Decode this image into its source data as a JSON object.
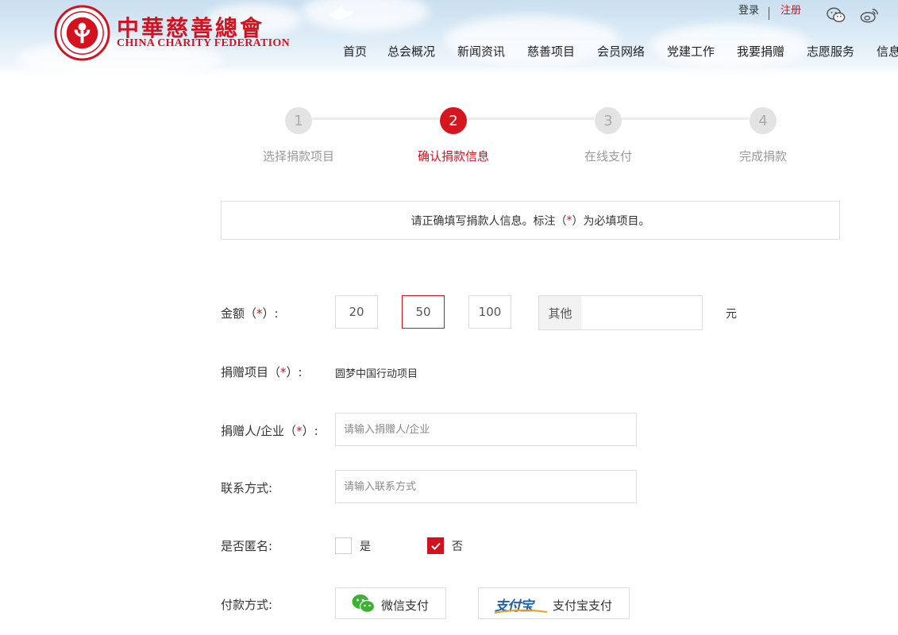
{
  "header": {
    "logo_cn": "中華慈善總會",
    "logo_en": "CHINA CHARITY FEDERATION",
    "top_links": {
      "login": "登录",
      "register": "注册"
    },
    "social": [
      "wechat-icon",
      "weibo-icon"
    ],
    "nav": [
      "首页",
      "总会概况",
      "新闻资讯",
      "慈善项目",
      "会员网络",
      "党建工作",
      "我要捐赠",
      "志愿服务",
      "信息"
    ]
  },
  "steps": [
    {
      "num": "1",
      "label": "选择捐款项目",
      "state": "done"
    },
    {
      "num": "2",
      "label": "确认捐款信息",
      "state": "active"
    },
    {
      "num": "3",
      "label": "在线支付",
      "state": "pending"
    },
    {
      "num": "4",
      "label": "完成捐款",
      "state": "pending"
    }
  ],
  "notice": {
    "prefix": "请正确填写捐款人信息。标注（",
    "star": "*",
    "suffix": "）为必填项目。"
  },
  "form": {
    "amount": {
      "label_prefix": "金额（",
      "label_star": "*",
      "label_suffix": "）:",
      "options": [
        "20",
        "50",
        "100"
      ],
      "selected": "50",
      "other_label": "其他",
      "other_value": "",
      "unit": "元"
    },
    "project": {
      "label_prefix": "捐赠项目（",
      "label_star": "*",
      "label_suffix": "）:",
      "value": "圆梦中国行动项目"
    },
    "donor": {
      "label_prefix": "捐赠人/企业（",
      "label_star": "*",
      "label_suffix": "）:",
      "placeholder": "请输入捐赠人/企业",
      "value": ""
    },
    "contact": {
      "label": "联系方式:",
      "placeholder": "请输入联系方式",
      "value": ""
    },
    "anonymous": {
      "label": "是否匿名:",
      "yes": "是",
      "no": "否",
      "selected": "no"
    },
    "payment": {
      "label": "付款方式:",
      "wechat": "微信支付",
      "alipay_logo": "支付宝",
      "alipay": "支付宝支付"
    }
  },
  "colors": {
    "brand_red": "#d4121f",
    "wechat_green": "#3eb135",
    "alipay_blue": "#1d62ac"
  }
}
